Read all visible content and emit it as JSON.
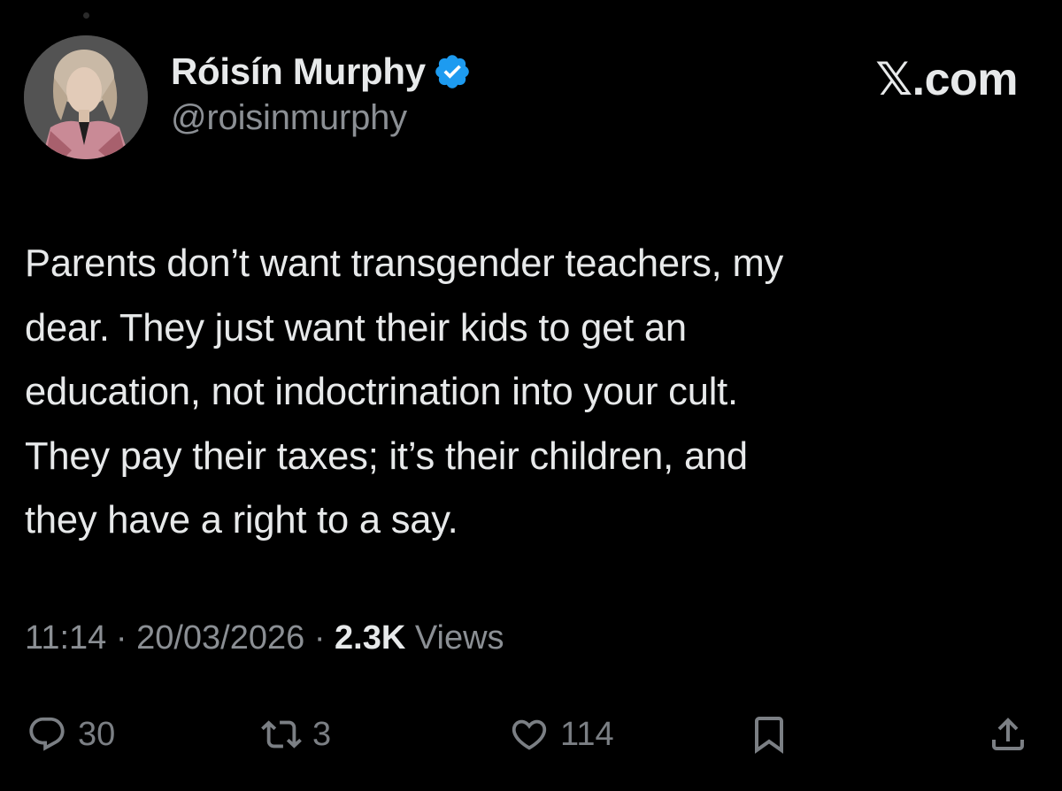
{
  "colors": {
    "background": "#000000",
    "primary_text": "#e7e9ea",
    "secondary_text": "#8b8f94",
    "verified_badge": "#1d9bf0"
  },
  "author": {
    "display_name": "Róisín Murphy",
    "handle": "@roisinmurphy",
    "verified": true,
    "avatar_icon": "profile-photo"
  },
  "brand": {
    "label": "𝕏.com"
  },
  "tweet": {
    "lines": [
      "Parents don’t want transgender teachers, my",
      "dear. They just want their kids to get an",
      "education, not indoctrination into your cult.",
      "They pay their taxes; it’s their children, and",
      "they have a right to a say."
    ]
  },
  "meta": {
    "time": "11:14",
    "separator": "·",
    "date": "20/03/2026",
    "views_count": "2.3K",
    "views_label": "Views"
  },
  "actions": {
    "reply": {
      "icon": "reply-icon",
      "count": "30"
    },
    "retweet": {
      "icon": "retweet-icon",
      "count": "3"
    },
    "like": {
      "icon": "heart-icon",
      "count": "114"
    },
    "bookmark": {
      "icon": "bookmark-icon"
    },
    "share": {
      "icon": "share-icon"
    }
  }
}
